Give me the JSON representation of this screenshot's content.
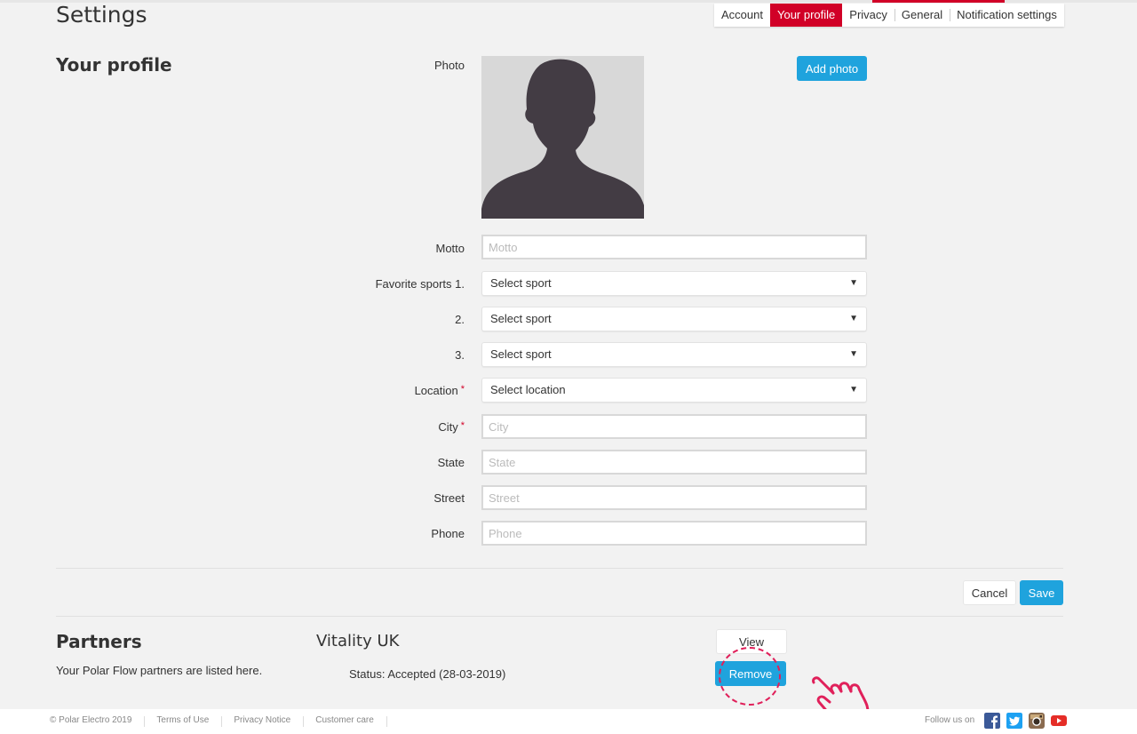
{
  "header": {
    "title": "Settings",
    "tabs": [
      {
        "label": "Account",
        "active": false
      },
      {
        "label": "Your profile",
        "active": true
      },
      {
        "label": "Privacy",
        "active": false
      },
      {
        "label": "General",
        "active": false
      },
      {
        "label": "Notification settings",
        "active": false
      }
    ]
  },
  "profile": {
    "section_title": "Your profile",
    "photo_label": "Photo",
    "add_photo_label": "Add photo",
    "motto": {
      "label": "Motto",
      "value": "",
      "placeholder": "Motto"
    },
    "favorite_sports": [
      {
        "label": "Favorite sports 1.",
        "value": "Select sport"
      },
      {
        "label": "2.",
        "value": "Select sport"
      },
      {
        "label": "3.",
        "value": "Select sport"
      }
    ],
    "location": {
      "label": "Location",
      "value": "Select location",
      "required_mark": "*"
    },
    "city": {
      "label": "City",
      "value": "",
      "placeholder": "City",
      "required_mark": "*"
    },
    "state": {
      "label": "State",
      "value": "",
      "placeholder": "State"
    },
    "street": {
      "label": "Street",
      "value": "",
      "placeholder": "Street"
    },
    "phone": {
      "label": "Phone",
      "value": "",
      "placeholder": "Phone"
    },
    "cancel_label": "Cancel",
    "save_label": "Save"
  },
  "partners": {
    "section_title": "Partners",
    "description": "Your Polar Flow partners are listed here.",
    "items": [
      {
        "name": "Vitality UK",
        "status": "Status: Accepted (28-03-2019)",
        "view_label": "View",
        "remove_label": "Remove"
      }
    ]
  },
  "footer": {
    "copyright": "© Polar Electro 2019",
    "links": [
      "Terms of Use",
      "Privacy Notice",
      "Customer care"
    ],
    "follow_label": "Follow us on",
    "social": [
      "facebook-icon",
      "twitter-icon",
      "instagram-icon",
      "youtube-icon"
    ]
  },
  "colors": {
    "brand_red": "#d10027",
    "button_blue": "#1fa3dd",
    "background": "#f2f2f2",
    "highlight_pink": "#e0205a"
  }
}
